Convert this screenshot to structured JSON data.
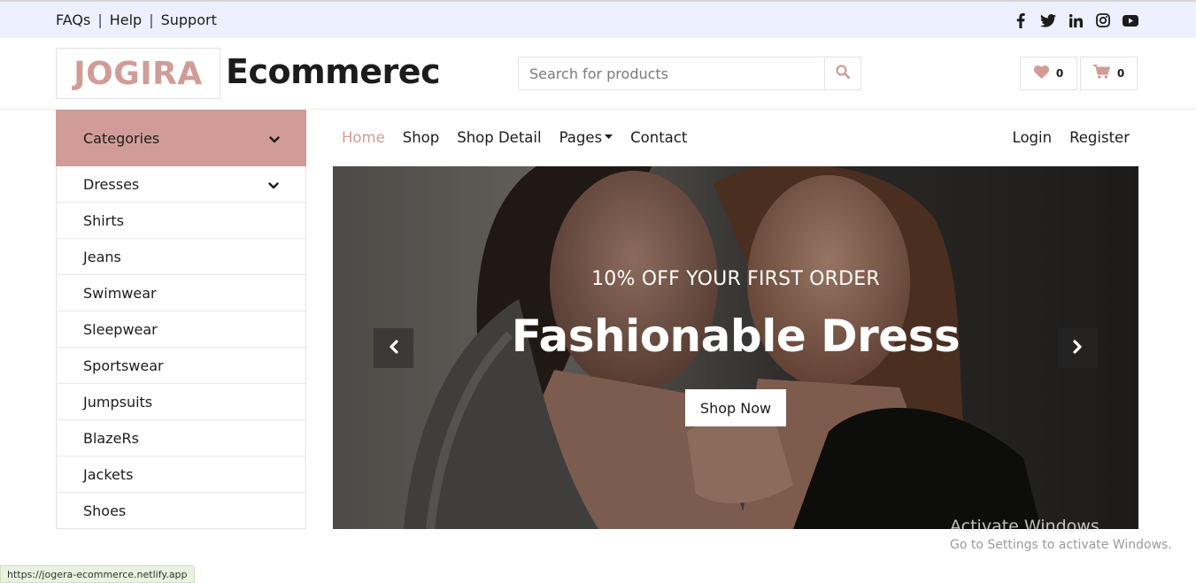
{
  "topbar": {
    "links": [
      "FAQs",
      "Help",
      "Support"
    ],
    "separator": "|",
    "social_icons": [
      "facebook-icon",
      "twitter-icon",
      "linkedin-icon",
      "instagram-icon",
      "youtube-icon"
    ]
  },
  "header": {
    "logo_mark": "JOGIRA",
    "logo_text": "Ecommerec",
    "search_placeholder": "Search for products",
    "wishlist_count": "0",
    "cart_count": "0"
  },
  "categories": {
    "title": "Categories",
    "items": [
      {
        "label": "Dresses",
        "has_submenu": true
      },
      {
        "label": "Shirts"
      },
      {
        "label": "Jeans"
      },
      {
        "label": "Swimwear"
      },
      {
        "label": "Sleepwear"
      },
      {
        "label": "Sportswear"
      },
      {
        "label": "Jumpsuits"
      },
      {
        "label": "BlazeRs"
      },
      {
        "label": "Jackets"
      },
      {
        "label": "Shoes"
      }
    ]
  },
  "nav": {
    "items": [
      "Home",
      "Shop",
      "Shop Detail",
      "Pages",
      "Contact"
    ],
    "active": "Home",
    "right": [
      "Login",
      "Register"
    ]
  },
  "hero": {
    "subtitle": "10% OFF YOUR FIRST ORDER",
    "title": "Fashionable Dress",
    "cta": "Shop Now"
  },
  "watermark": {
    "line1": "Activate Windows",
    "line2": "Go to Settings to activate Windows."
  },
  "status_url": "https://jogera-ecommerce.netlify.app",
  "colors": {
    "accent": "#d19c97",
    "topbar_bg": "#edf1ff",
    "text": "#1c1c1c",
    "border": "#e3e3e3"
  }
}
